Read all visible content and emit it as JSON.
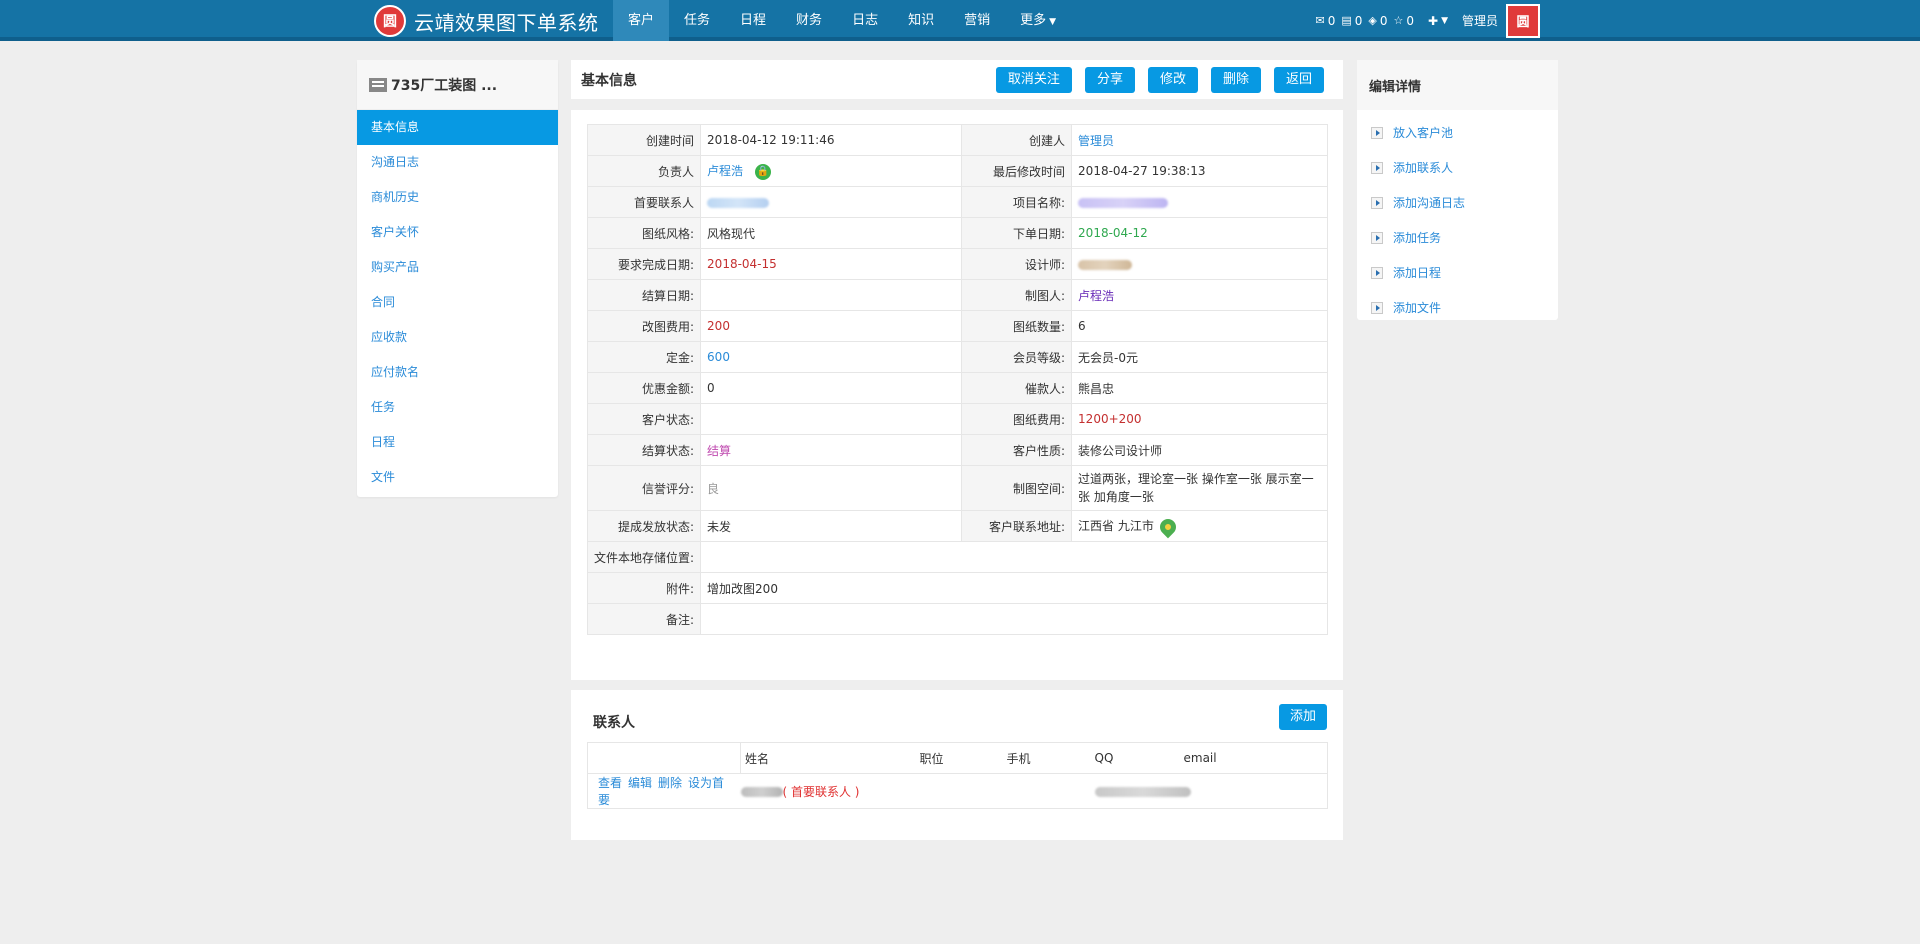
{
  "app": {
    "logo_text": "圆",
    "title": "云靖效果图下单系统"
  },
  "nav": {
    "items": [
      "客户",
      "任务",
      "日程",
      "财务",
      "日志",
      "知识",
      "营销"
    ],
    "more": "更多"
  },
  "topright": {
    "mail_count": "0",
    "msg_count": "0",
    "task_count": "0",
    "star_count": "0",
    "plus": "✚",
    "user": "管理员"
  },
  "sidebar": {
    "customer_name": "735厂工装图 ...",
    "items": [
      "基本信息",
      "沟通日志",
      "商机历史",
      "客户关怀",
      "购买产品",
      "合同",
      "应收款",
      "应付款名",
      "任务",
      "日程",
      "文件"
    ]
  },
  "main": {
    "title": "基本信息",
    "buttons": [
      "取消关注",
      "分享",
      "修改",
      "删除",
      "返回"
    ]
  },
  "info": {
    "created_time_label": "创建时间",
    "created_time": "2018-04-12 19:11:46",
    "creator_label": "创建人",
    "creator": "管理员",
    "owner_label": "负责人",
    "owner": "卢程浩",
    "last_modified_label": "最后修改时间",
    "last_modified": "2018-04-27 19:38:13",
    "primary_contact_label": "首要联系人",
    "project_name_label": "项目名称:",
    "drawing_style_label": "图纸风格:",
    "drawing_style": "风格现代",
    "order_date_label": "下单日期:",
    "order_date": "2018-04-12",
    "due_date_label": "要求完成日期:",
    "due_date": "2018-04-15",
    "designer_label": "设计师:",
    "settle_date_label": "结算日期:",
    "drafter_label": "制图人:",
    "drafter": "卢程浩",
    "revise_fee_label": "改图费用:",
    "revise_fee": "200",
    "drawing_count_label": "图纸数量:",
    "drawing_count": "6",
    "deposit_label": "定金:",
    "deposit": "600",
    "member_level_label": "会员等级:",
    "member_level": "无会员-0元",
    "discount_label": "优惠金额:",
    "discount": "0",
    "collector_label": "催款人:",
    "collector": "熊昌忠",
    "customer_status_label": "客户状态:",
    "drawing_fee_label": "图纸费用:",
    "drawing_fee": "1200+200",
    "settle_status_label": "结算状态:",
    "settle_status": "结算",
    "customer_nature_label": "客户性质:",
    "customer_nature": "装修公司设计师",
    "credit_label": "信誉评分:",
    "credit": "良",
    "drawing_space_label": "制图空间:",
    "drawing_space": "过道两张，理论室一张 操作室一张 展示室一张 加角度一张",
    "commission_label": "提成发放状态:",
    "commission": "未发",
    "address_label": "客户联系地址:",
    "address": "江西省 九江市",
    "file_location_label": "文件本地存储位置:",
    "attachment_label": "附件:",
    "attachment": "增加改图200",
    "remark_label": "备注:"
  },
  "contacts": {
    "title": "联系人",
    "add_label": "添加",
    "headers": [
      "姓名",
      "职位",
      "手机",
      "QQ",
      "email"
    ],
    "actions": [
      "查看",
      "编辑",
      "删除",
      "设为首要"
    ],
    "primary_tag": "( 首要联系人 )"
  },
  "rightpanel": {
    "title": "编辑详情",
    "items": [
      "放入客户池",
      "添加联系人",
      "添加沟通日志",
      "添加任务",
      "添加日程",
      "添加文件"
    ]
  },
  "colors": {
    "nav_bg": "#1573a5",
    "accent": "#0799e3",
    "link": "#2a8bd8"
  }
}
